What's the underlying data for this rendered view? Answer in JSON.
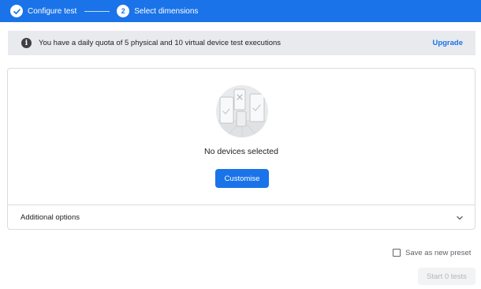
{
  "stepper": {
    "steps": [
      {
        "label": "Configure test",
        "state": "completed",
        "icon": "check-icon"
      },
      {
        "label": "Select dimensions",
        "state": "active",
        "number": "2"
      }
    ],
    "background_color": "#1a73e8"
  },
  "banner": {
    "icon": "info-icon",
    "text": "You have a daily quota of 5 physical and 10 virtual device test executions",
    "upgrade_label": "Upgrade"
  },
  "devices": {
    "illustration": "devices-illustration",
    "empty_title": "No devices selected",
    "customise_label": "Customise"
  },
  "additional_options": {
    "label": "Additional options",
    "icon": "chevron-down-icon",
    "expanded": false
  },
  "footer": {
    "preset_label": "Save as new preset",
    "preset_checked": false,
    "start_label": "Start 0 tests",
    "start_enabled": false
  },
  "colors": {
    "accent": "#1a73e8",
    "banner_background": "#e8eaed",
    "disabled_text": "#b3b6ba"
  }
}
